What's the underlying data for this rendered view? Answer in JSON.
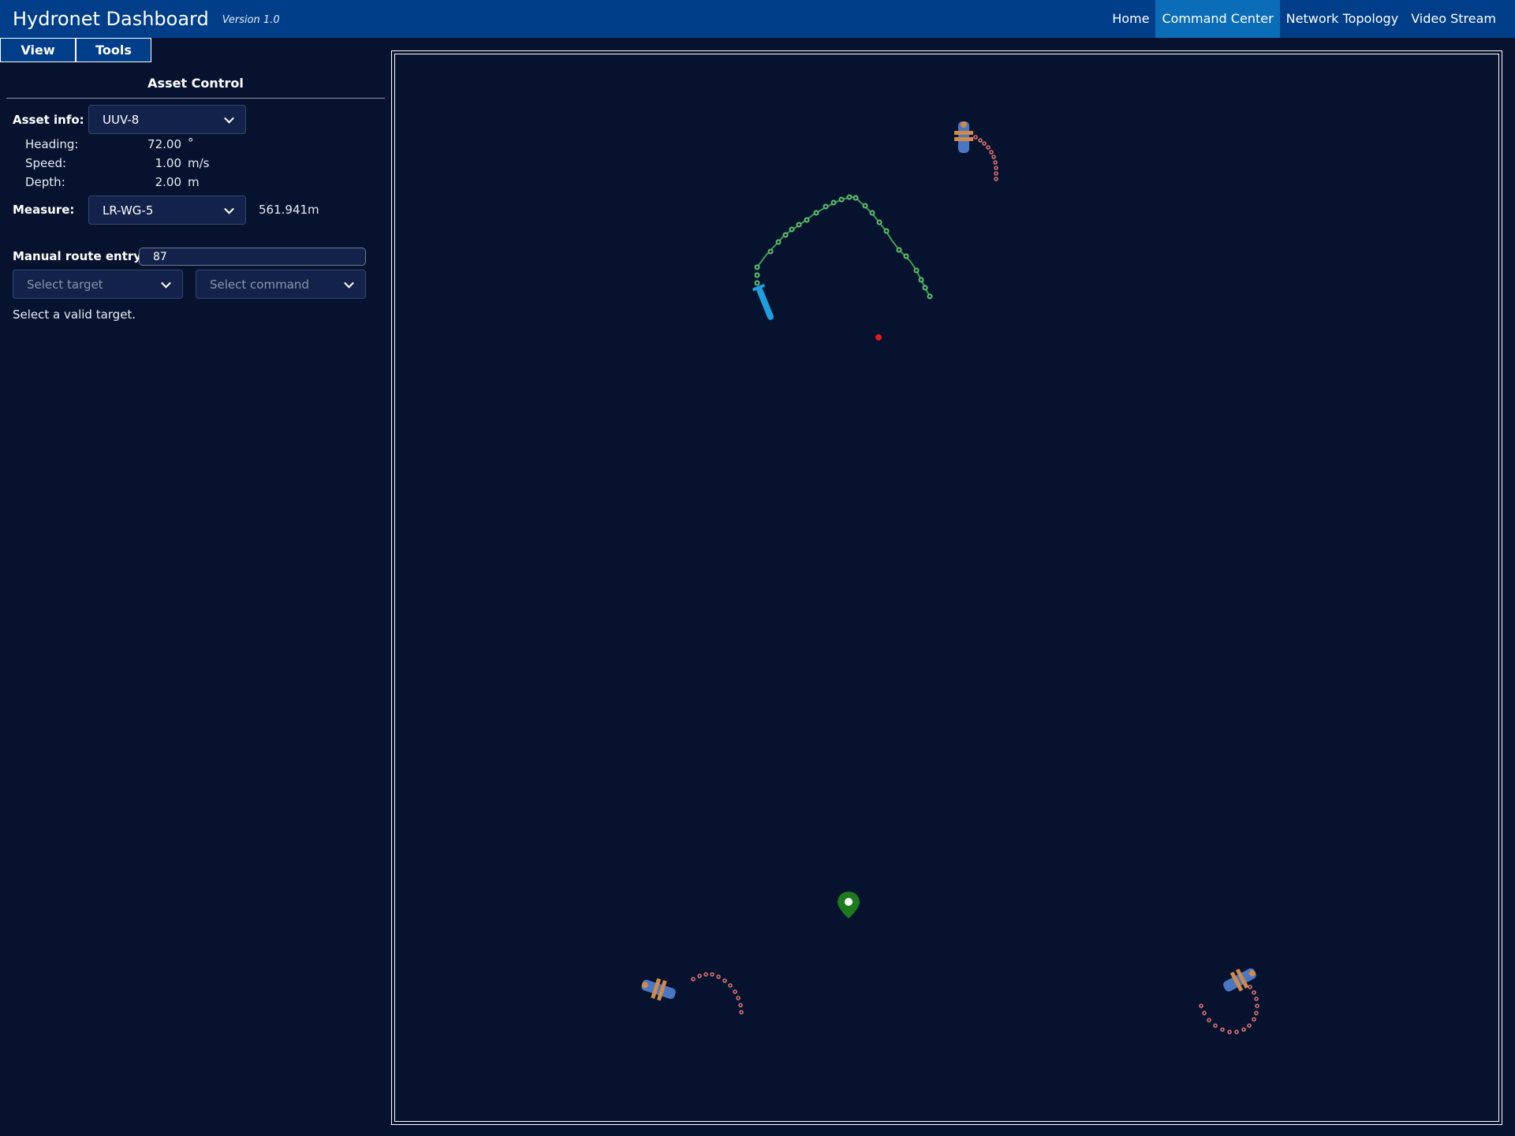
{
  "app": {
    "title": "Hydronet Dashboard",
    "version": "Version 1.0"
  },
  "nav": [
    {
      "label": "Home",
      "active": false
    },
    {
      "label": "Command Center",
      "active": true
    },
    {
      "label": "Network Topology",
      "active": false
    },
    {
      "label": "Video Stream",
      "active": false
    }
  ],
  "tabs": {
    "view": "View",
    "tools": "Tools"
  },
  "panel": {
    "title": "Asset Control",
    "asset_info_label": "Asset info:",
    "asset_selected": "UUV-8",
    "heading": {
      "label": "Heading:",
      "value": "72.00",
      "unit": "°"
    },
    "speed": {
      "label": "Speed:",
      "value": "1.00",
      "unit": "m/s"
    },
    "depth": {
      "label": "Depth:",
      "value": "2.00",
      "unit": "m"
    },
    "measure_label": "Measure:",
    "measure_selected": "LR-WG-5",
    "measure_value": "561.941m",
    "route_label": "Manual route entry:",
    "route_value": "87",
    "target_placeholder": "Select target",
    "command_placeholder": "Select command",
    "status": "Select a valid target."
  },
  "map": {
    "colors": {
      "background": "#07132e",
      "uuv_trail": "#3f9a4e",
      "glider_trail": "#d86f6f",
      "uuv": "#1e9fe0",
      "glider_body": "#4a76c4",
      "glider_fins": "#d18a4a",
      "red_marker": "#e01b1b",
      "pin": "#1d7a1d"
    },
    "icons": [
      "uuv-icon",
      "wave-glider-icon",
      "location-pin-icon",
      "target-dot-icon"
    ]
  }
}
